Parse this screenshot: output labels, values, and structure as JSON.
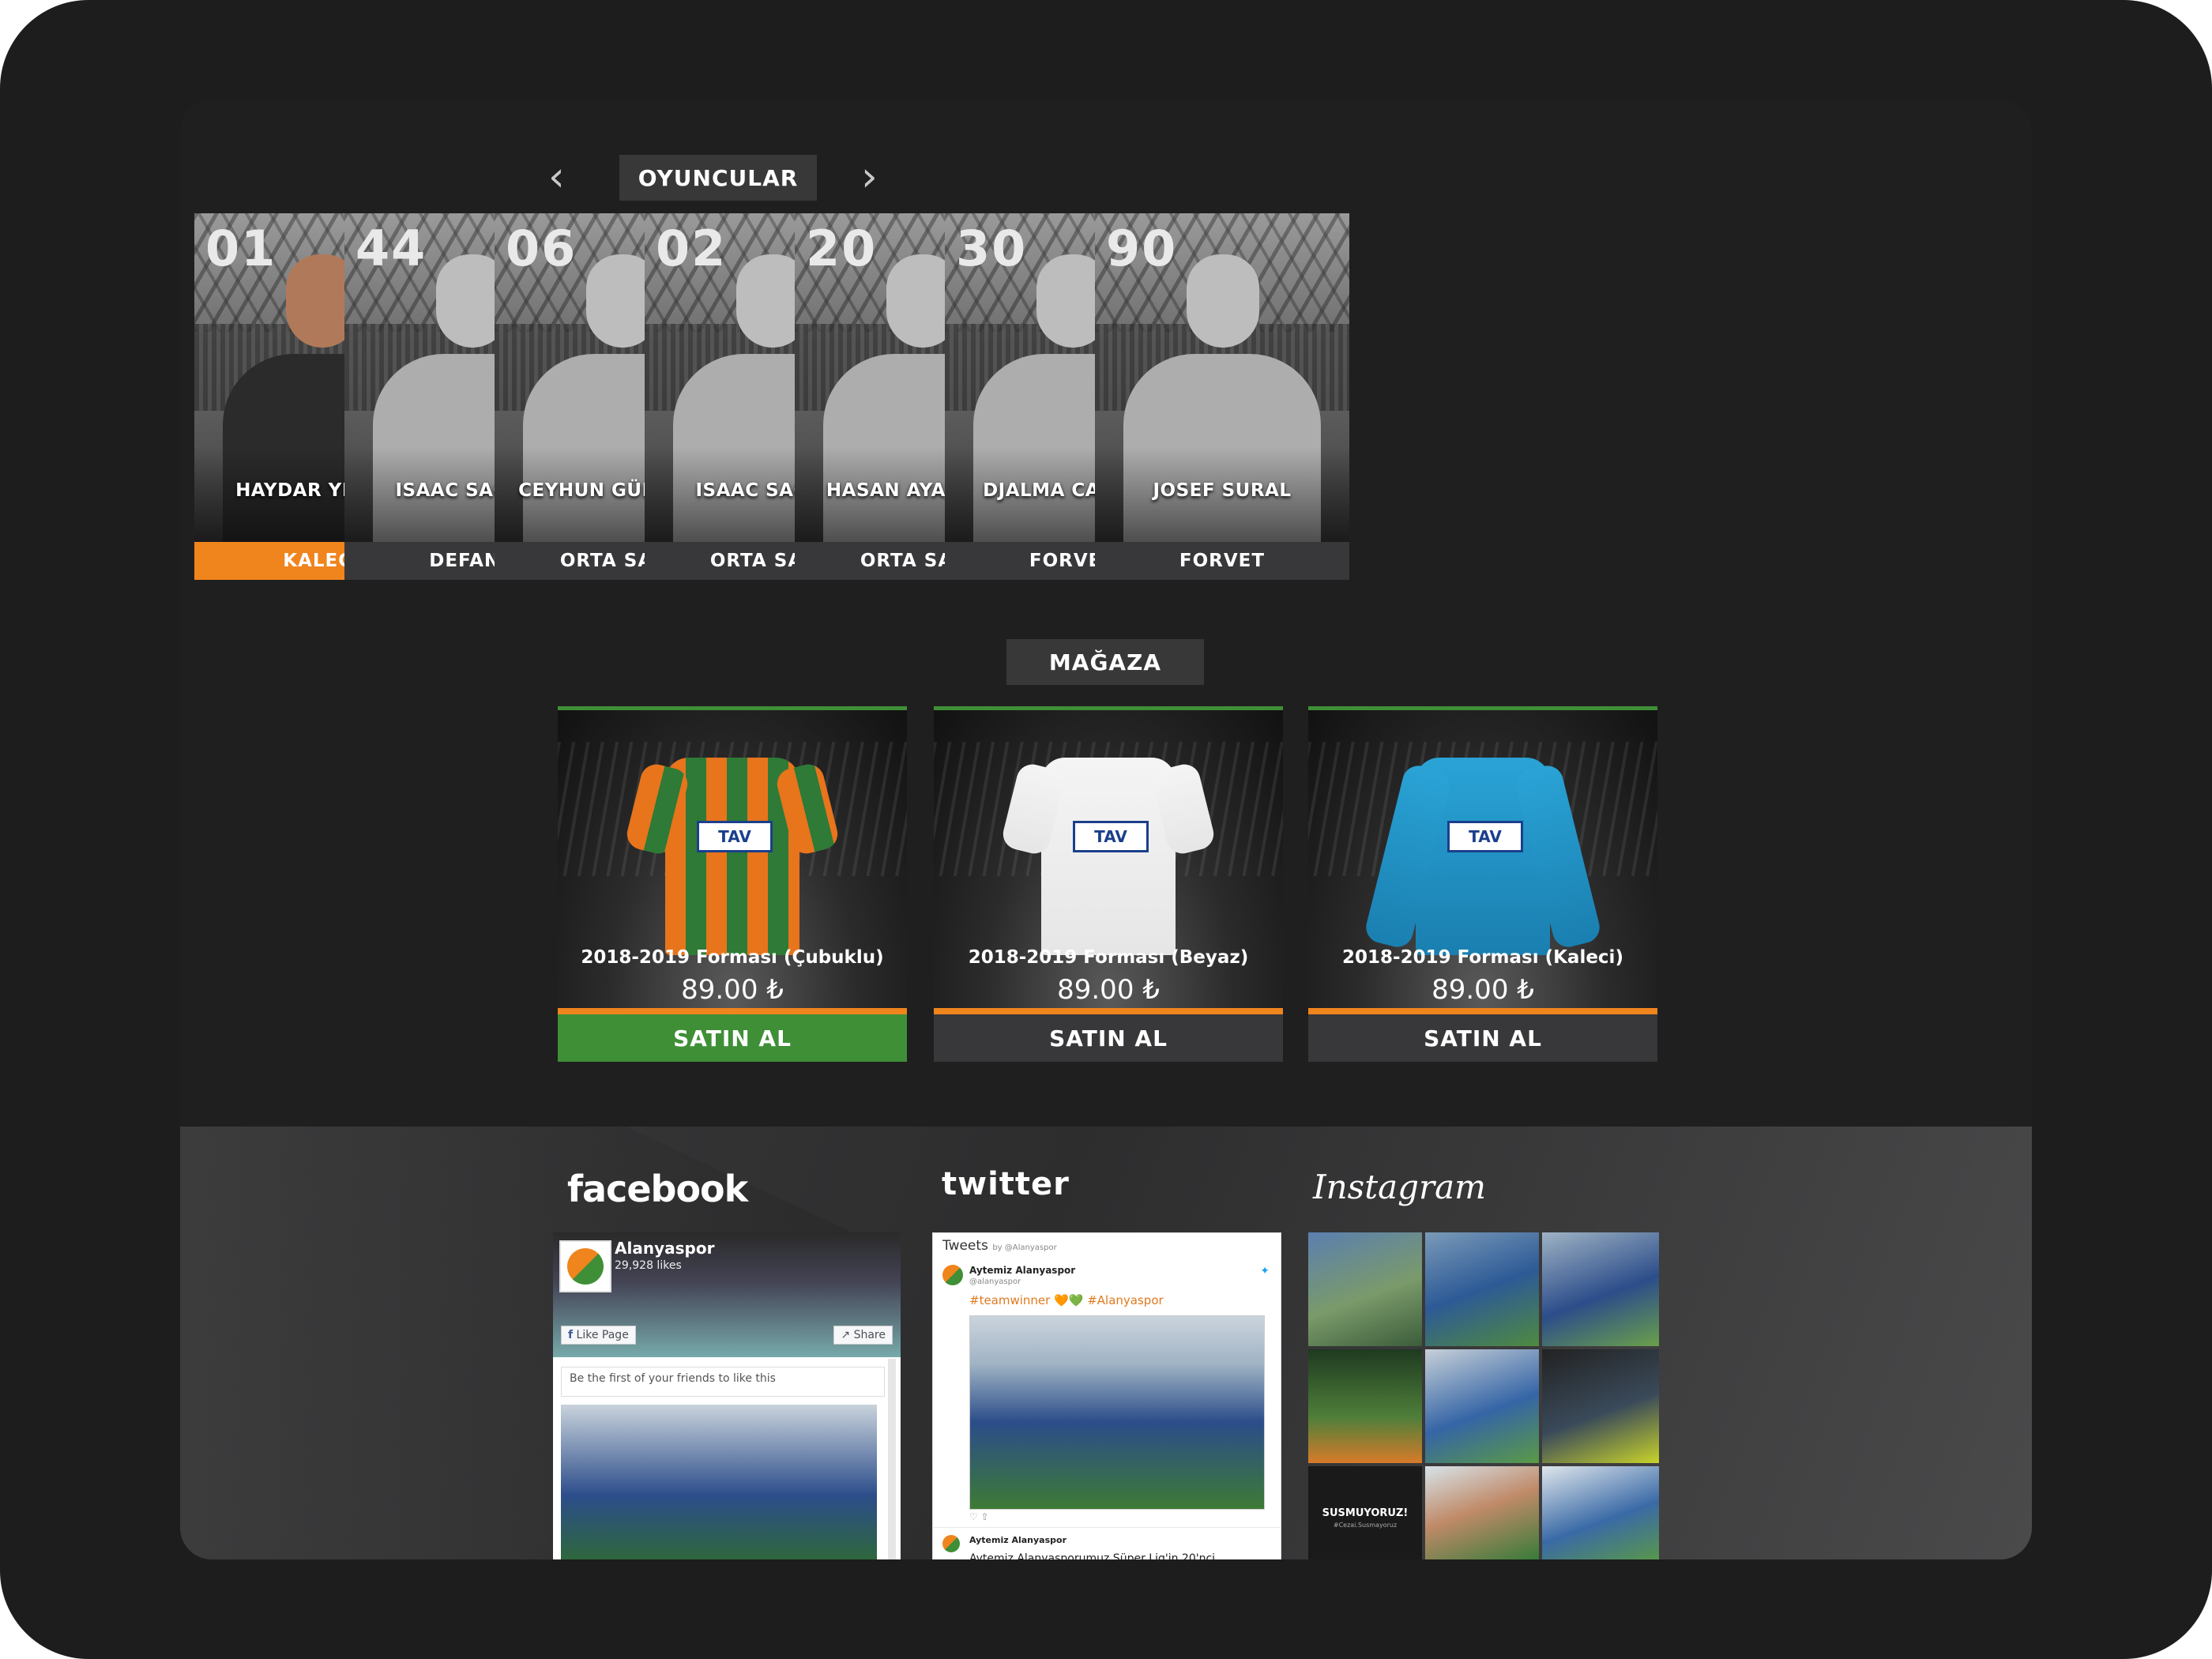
{
  "players_section": {
    "title": "OYUNCULAR",
    "prev_icon": "chevron-left-icon",
    "next_icon": "chevron-right-icon"
  },
  "players": [
    {
      "number": "01",
      "name": "HAYDAR YILMAZ",
      "position": "KALECİ",
      "active": true
    },
    {
      "number": "44",
      "name": "ISAAC SACKEY",
      "position": "DEFANS",
      "active": false
    },
    {
      "number": "06",
      "name": "CEYHUN GÜLSELAM",
      "position": "ORTA SAHA",
      "active": false
    },
    {
      "number": "02",
      "name": "ISAAC SACKEY",
      "position": "ORTA SAHA",
      "active": false
    },
    {
      "number": "20",
      "name": "HASAN AYAROĞLU",
      "position": "ORTA SAHA",
      "active": false
    },
    {
      "number": "30",
      "name": "DJALMA CAMPOS",
      "position": "FORVET",
      "active": false
    },
    {
      "number": "90",
      "name": "JOSEF SURAL",
      "position": "FORVET",
      "active": false
    }
  ],
  "store_section": {
    "title": "MAĞAZA"
  },
  "products": [
    {
      "name": "2018-2019 Forması (Çubuklu)",
      "price": "89.00 ₺",
      "button": "SATIN AL",
      "featured": true
    },
    {
      "name": "2018-2019 Forması (Beyaz)",
      "price": "89.00 ₺",
      "button": "SATIN AL",
      "featured": false
    },
    {
      "name": "2018-2019 Forması (Kaleci)",
      "price": "89.00 ₺",
      "button": "SATIN AL",
      "featured": false
    }
  ],
  "social": {
    "facebook": {
      "brand": "facebook",
      "page_name": "Alanyaspor",
      "likes": "29,928 likes",
      "like_button": "Like Page",
      "share_button": "Share",
      "friends_text": "Be the first of your friends to like this"
    },
    "twitter": {
      "brand": "twitter",
      "header": "Tweets",
      "by": "by @Alanyaspor",
      "tweet_author": "Aytemiz Alanyaspor",
      "tweet_handle": "@alanyaspor",
      "tweet_text": "#teamwinner 🧡💚 #Alanyaspor",
      "tweet2_author": "Aytemiz Alanyaspor",
      "tweet2_text": "Aytemiz Alanyasporumuz Süper Lig'in 20'nci"
    },
    "instagram": {
      "brand": "Instagram",
      "tile_text": "SUSMUYORUZ!",
      "tile_sub": "#Cezai.Susmayoruz"
    }
  },
  "colors": {
    "accent": "#f0841d",
    "green": "#3f8f37",
    "dark": "#1f1f20",
    "tab": "#38383a"
  }
}
